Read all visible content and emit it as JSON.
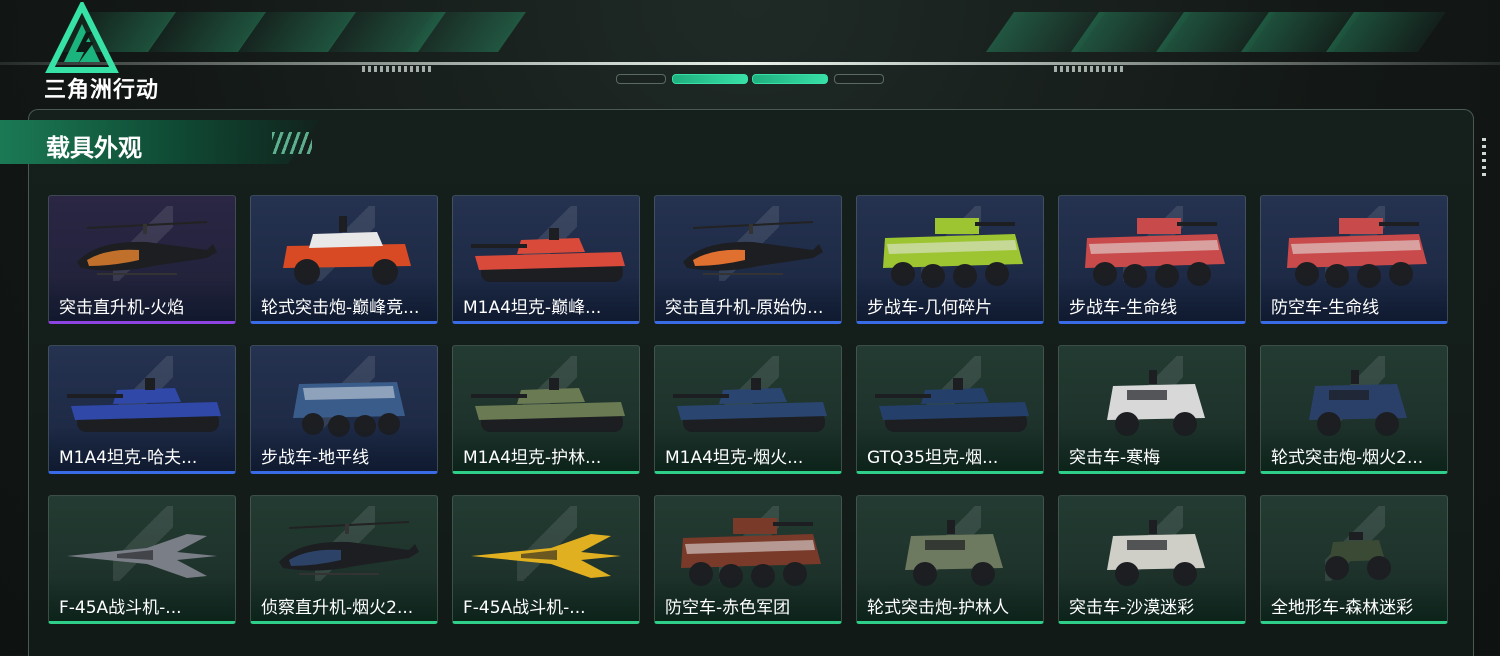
{
  "brand": {
    "logo_text": "三角洲行动"
  },
  "section": {
    "title": "载具外观"
  },
  "colors": {
    "purple": "#8d43e2",
    "blue": "#3a6be6",
    "green": "#2fcf8a",
    "accent": "#38e0a6"
  },
  "vehicles": [
    {
      "name": "突击直升机-火焰",
      "quality": "purple",
      "kind": "helicopter",
      "tint": "#c0702a"
    },
    {
      "name": "轮式突击炮-巅峰竞...",
      "quality": "blue",
      "kind": "jeep",
      "tint": "#d84a24"
    },
    {
      "name": "M1A4坦克-巅峰...",
      "quality": "blue",
      "kind": "tank",
      "tint": "#d94a3a"
    },
    {
      "name": "突击直升机-原始伪...",
      "quality": "blue",
      "kind": "helicopter",
      "tint": "#e07030"
    },
    {
      "name": "步战车-几何碎片",
      "quality": "blue",
      "kind": "ifv",
      "tint": "#9cc531"
    },
    {
      "name": "步战车-生命线",
      "quality": "blue",
      "kind": "ifv",
      "tint": "#c84a4a"
    },
    {
      "name": "防空车-生命线",
      "quality": "blue",
      "kind": "ifv",
      "tint": "#c84a4a"
    },
    {
      "name": "M1A4坦克-哈夫...",
      "quality": "blue",
      "kind": "tank",
      "tint": "#3048a8"
    },
    {
      "name": "步战车-地平线",
      "quality": "blue",
      "kind": "apc",
      "tint": "#3a5c8a"
    },
    {
      "name": "M1A4坦克-护林...",
      "quality": "green",
      "kind": "tank",
      "tint": "#6a7a52"
    },
    {
      "name": "M1A4坦克-烟火...",
      "quality": "green",
      "kind": "tank",
      "tint": "#2a4670"
    },
    {
      "name": "GTQ35坦克-烟...",
      "quality": "green",
      "kind": "tank",
      "tint": "#24406a"
    },
    {
      "name": "突击车-寒梅",
      "quality": "green",
      "kind": "truck",
      "tint": "#d8d8d8"
    },
    {
      "name": "轮式突击炮-烟火2...",
      "quality": "green",
      "kind": "truck",
      "tint": "#2a4068"
    },
    {
      "name": "F-45A战斗机-...",
      "quality": "green",
      "kind": "jet",
      "tint": "#7a7e86"
    },
    {
      "name": "侦察直升机-烟火2...",
      "quality": "green",
      "kind": "helicopter",
      "tint": "#2c4266"
    },
    {
      "name": "F-45A战斗机-...",
      "quality": "green",
      "kind": "jet",
      "tint": "#e0b020"
    },
    {
      "name": "防空车-赤色军团",
      "quality": "green",
      "kind": "ifv",
      "tint": "#7a3a2a"
    },
    {
      "name": "轮式突击炮-护林人",
      "quality": "green",
      "kind": "truck",
      "tint": "#6e7a60"
    },
    {
      "name": "突击车-沙漠迷彩",
      "quality": "green",
      "kind": "truck",
      "tint": "#cfcfc8"
    },
    {
      "name": "全地形车-森林迷彩",
      "quality": "green",
      "kind": "atv",
      "tint": "#3a4a34"
    }
  ]
}
